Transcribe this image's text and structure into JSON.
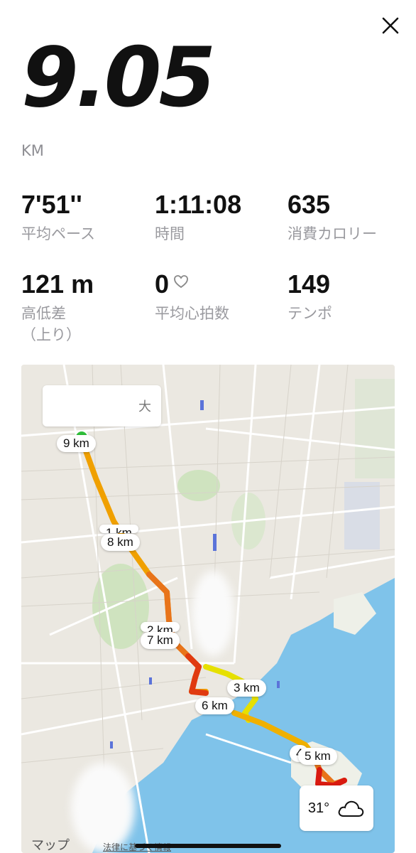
{
  "close_label": "×",
  "summary": {
    "distance": "9.05",
    "unit": "KM"
  },
  "stats": [
    {
      "value": "7'51''",
      "label": "平均ペース"
    },
    {
      "value": "1:11:08",
      "label": "時間"
    },
    {
      "value": "635",
      "label": "消費カロリー"
    },
    {
      "value": "121 m",
      "label": "高低差",
      "label2": "（上り）"
    },
    {
      "value": "0",
      "label": "平均心拍数"
    },
    {
      "value": "149",
      "label": "テンポ"
    }
  ],
  "map": {
    "km_markers": [
      "9 km",
      "1 km",
      "8 km",
      "2 km",
      "7 km",
      "3 km",
      "6 km",
      "4",
      "5 km"
    ],
    "weather_temp": "31°",
    "weather_icon": "cloud-icon",
    "maps_brand": "マップ",
    "legal_link": "法律に基づく情報",
    "route_colors": [
      "#f0b000",
      "#f08a00",
      "#e03a10",
      "#d8dd00"
    ],
    "sea_color": "#7fc3ea",
    "search_fragment": "大"
  }
}
